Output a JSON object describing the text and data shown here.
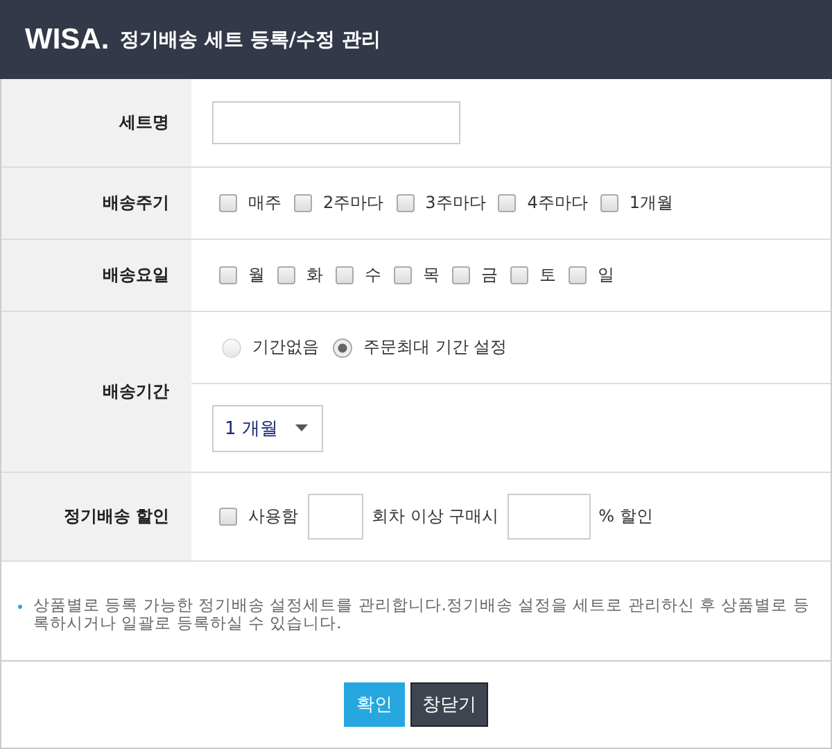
{
  "header": {
    "logo": "WISA.",
    "title": "정기배송 세트 등록/수정 관리"
  },
  "set_name": {
    "label": "세트명"
  },
  "delivery_cycle": {
    "label": "배송주기",
    "options": [
      {
        "label": "매주",
        "checked": false
      },
      {
        "label": "2주마다",
        "checked": false
      },
      {
        "label": "3주마다",
        "checked": false
      },
      {
        "label": "4주마다",
        "checked": false
      },
      {
        "label": "1개월",
        "checked": false
      }
    ]
  },
  "delivery_days": {
    "label": "배송요일",
    "options": [
      {
        "label": "월",
        "checked": false
      },
      {
        "label": "화",
        "checked": false
      },
      {
        "label": "수",
        "checked": false
      },
      {
        "label": "목",
        "checked": false
      },
      {
        "label": "금",
        "checked": false
      },
      {
        "label": "토",
        "checked": false
      },
      {
        "label": "일",
        "checked": false
      }
    ]
  },
  "delivery_period": {
    "label": "배송기간",
    "options": [
      {
        "label": "기간없음",
        "selected": false,
        "disabled": true
      },
      {
        "label": "주문최대 기간 설정",
        "selected": true,
        "disabled": false
      }
    ],
    "select": {
      "value": "1 개월"
    }
  },
  "discount": {
    "label": "정기배송 할인",
    "use": {
      "label": "사용함",
      "checked": false
    },
    "text_after_count": "회차 이상 구매시",
    "text_after_percent": "% 할인"
  },
  "note": "상품별로 등록 가능한 정기배송 설정세트를 관리합니다.정기배송 설정을 세트로 관리하신 후 상품별로 등록하시거나 일괄로 등록하실 수 있습니다.",
  "buttons": [
    {
      "label": "확인",
      "kind": "primary"
    },
    {
      "label": "창닫기",
      "kind": "secondary"
    }
  ]
}
